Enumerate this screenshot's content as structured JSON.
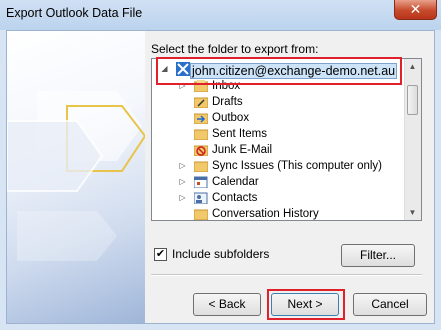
{
  "window": {
    "title": "Export Outlook Data File",
    "close_symbol": "✕"
  },
  "prompt": "Select the folder to export from:",
  "tree": {
    "root": "john.citizen@exchange-demo.net.au",
    "items": [
      {
        "label": "Inbox",
        "icon": "inbox-folder-icon",
        "expandable": true
      },
      {
        "label": "Drafts",
        "icon": "drafts-folder-icon",
        "expandable": false
      },
      {
        "label": "Outbox",
        "icon": "outbox-folder-icon",
        "expandable": false
      },
      {
        "label": "Sent Items",
        "icon": "sent-items-folder-icon",
        "expandable": false
      },
      {
        "label": "Junk E-Mail",
        "icon": "junk-mail-folder-icon",
        "expandable": false
      },
      {
        "label": "Sync Issues (This computer only)",
        "icon": "sync-folder-icon",
        "expandable": true
      },
      {
        "label": "Calendar",
        "icon": "calendar-icon",
        "expandable": true
      },
      {
        "label": "Contacts",
        "icon": "contacts-icon",
        "expandable": true
      },
      {
        "label": "Conversation History",
        "icon": "folder-icon",
        "expandable": false
      }
    ]
  },
  "include_subfolders": {
    "label": "Include subfolders",
    "checked": true,
    "check_glyph": "✔"
  },
  "buttons": {
    "filter": "Filter...",
    "back": "< Back",
    "next": "Next >",
    "cancel": "Cancel"
  },
  "colors": {
    "highlight_outline": "#e0202a",
    "selection": "#cde3f8"
  }
}
